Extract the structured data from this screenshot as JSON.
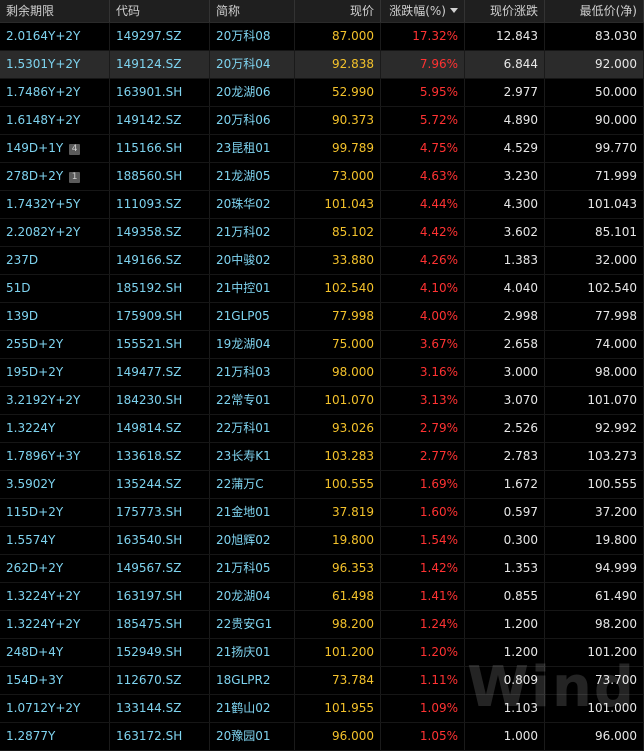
{
  "header": {
    "columns": [
      "剩余期限",
      "代码",
      "简称",
      "现价",
      "涨跌幅(%)",
      "现价涨跌",
      "最低价(净)"
    ]
  },
  "selected_row_index": 1,
  "rows": [
    {
      "term": "2.0164Y+2Y",
      "badge": "",
      "code": "149297.SZ",
      "name": "20万科08",
      "price": "87.000",
      "pct": "17.32%",
      "chg": "12.843",
      "low": "83.030"
    },
    {
      "term": "1.5301Y+2Y",
      "badge": "",
      "code": "149124.SZ",
      "name": "20万科04",
      "price": "92.838",
      "pct": "7.96%",
      "chg": "6.844",
      "low": "92.000"
    },
    {
      "term": "1.7486Y+2Y",
      "badge": "",
      "code": "163901.SH",
      "name": "20龙湖06",
      "price": "52.990",
      "pct": "5.95%",
      "chg": "2.977",
      "low": "50.000"
    },
    {
      "term": "1.6148Y+2Y",
      "badge": "",
      "code": "149142.SZ",
      "name": "20万科06",
      "price": "90.373",
      "pct": "5.72%",
      "chg": "4.890",
      "low": "90.000"
    },
    {
      "term": "149D+1Y",
      "badge": "4",
      "code": "115166.SH",
      "name": "23昆租01",
      "price": "99.789",
      "pct": "4.75%",
      "chg": "4.529",
      "low": "99.770"
    },
    {
      "term": "278D+2Y",
      "badge": "1",
      "code": "188560.SH",
      "name": "21龙湖05",
      "price": "73.000",
      "pct": "4.63%",
      "chg": "3.230",
      "low": "71.999"
    },
    {
      "term": "1.7432Y+5Y",
      "badge": "",
      "code": "111093.SZ",
      "name": "20珠华02",
      "price": "101.043",
      "pct": "4.44%",
      "chg": "4.300",
      "low": "101.043"
    },
    {
      "term": "2.2082Y+2Y",
      "badge": "",
      "code": "149358.SZ",
      "name": "21万科02",
      "price": "85.102",
      "pct": "4.42%",
      "chg": "3.602",
      "low": "85.101"
    },
    {
      "term": "237D",
      "badge": "",
      "code": "149166.SZ",
      "name": "20中骏02",
      "price": "33.880",
      "pct": "4.26%",
      "chg": "1.383",
      "low": "32.000"
    },
    {
      "term": "51D",
      "badge": "",
      "code": "185192.SH",
      "name": "21中控01",
      "price": "102.540",
      "pct": "4.10%",
      "chg": "4.040",
      "low": "102.540"
    },
    {
      "term": "139D",
      "badge": "",
      "code": "175909.SH",
      "name": "21GLP05",
      "price": "77.998",
      "pct": "4.00%",
      "chg": "2.998",
      "low": "77.998"
    },
    {
      "term": "255D+2Y",
      "badge": "",
      "code": "155521.SH",
      "name": "19龙湖04",
      "price": "75.000",
      "pct": "3.67%",
      "chg": "2.658",
      "low": "74.000"
    },
    {
      "term": "195D+2Y",
      "badge": "",
      "code": "149477.SZ",
      "name": "21万科03",
      "price": "98.000",
      "pct": "3.16%",
      "chg": "3.000",
      "low": "98.000"
    },
    {
      "term": "3.2192Y+2Y",
      "badge": "",
      "code": "184230.SH",
      "name": "22常专01",
      "price": "101.070",
      "pct": "3.13%",
      "chg": "3.070",
      "low": "101.070"
    },
    {
      "term": "1.3224Y",
      "badge": "",
      "code": "149814.SZ",
      "name": "22万科01",
      "price": "93.026",
      "pct": "2.79%",
      "chg": "2.526",
      "low": "92.992"
    },
    {
      "term": "1.7896Y+3Y",
      "badge": "",
      "code": "133618.SZ",
      "name": "23长寿K1",
      "price": "103.283",
      "pct": "2.77%",
      "chg": "2.783",
      "low": "103.273"
    },
    {
      "term": "3.5902Y",
      "badge": "",
      "code": "135244.SZ",
      "name": "22蒲万C",
      "price": "100.555",
      "pct": "1.69%",
      "chg": "1.672",
      "low": "100.555"
    },
    {
      "term": "115D+2Y",
      "badge": "",
      "code": "175773.SH",
      "name": "21金地01",
      "price": "37.819",
      "pct": "1.60%",
      "chg": "0.597",
      "low": "37.200"
    },
    {
      "term": "1.5574Y",
      "badge": "",
      "code": "163540.SH",
      "name": "20旭辉02",
      "price": "19.800",
      "pct": "1.54%",
      "chg": "0.300",
      "low": "19.800"
    },
    {
      "term": "262D+2Y",
      "badge": "",
      "code": "149567.SZ",
      "name": "21万科05",
      "price": "96.353",
      "pct": "1.42%",
      "chg": "1.353",
      "low": "94.999"
    },
    {
      "term": "1.3224Y+2Y",
      "badge": "",
      "code": "163197.SH",
      "name": "20龙湖04",
      "price": "61.498",
      "pct": "1.41%",
      "chg": "0.855",
      "low": "61.490"
    },
    {
      "term": "1.3224Y+2Y",
      "badge": "",
      "code": "185475.SH",
      "name": "22贵安G1",
      "price": "98.200",
      "pct": "1.24%",
      "chg": "1.200",
      "low": "98.200"
    },
    {
      "term": "248D+4Y",
      "badge": "",
      "code": "152949.SH",
      "name": "21扬庆01",
      "price": "101.200",
      "pct": "1.20%",
      "chg": "1.200",
      "low": "101.200"
    },
    {
      "term": "154D+3Y",
      "badge": "",
      "code": "112670.SZ",
      "name": "18GLPR2",
      "price": "73.784",
      "pct": "1.11%",
      "chg": "0.809",
      "low": "73.700"
    },
    {
      "term": "1.0712Y+2Y",
      "badge": "",
      "code": "133144.SZ",
      "name": "21鹤山02",
      "price": "101.955",
      "pct": "1.09%",
      "chg": "1.103",
      "low": "101.000"
    },
    {
      "term": "1.2877Y",
      "badge": "",
      "code": "163172.SH",
      "name": "20豫园01",
      "price": "96.000",
      "pct": "1.05%",
      "chg": "1.000",
      "low": "96.000"
    }
  ],
  "watermark": "Wind",
  "colors": {
    "background": "#000000",
    "header_bg": "#1f1f1f",
    "text_cyan": "#7fd4f0",
    "price_yellow": "#f4c22b",
    "pct_red": "#ff3232",
    "value_white": "#e8e8e8"
  }
}
